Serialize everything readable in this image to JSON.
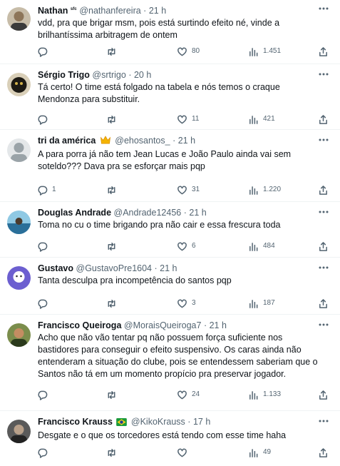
{
  "tweets": [
    {
      "name": "Nathan",
      "name_extra": "ˢᶠᶜ",
      "handle": "@nathanfereira",
      "time": "21 h",
      "text": "vdd, pra que brigar msm, pois está surtindo efeito né, vinde a brilhantíssima arbitragem de ontem",
      "replies": "",
      "retweets": "",
      "likes": "80",
      "views": "1.451",
      "avatar_color": "#b9a98f"
    },
    {
      "name": "Sérgio Trigo",
      "name_extra": "",
      "handle": "@srtrigo",
      "time": "20 h",
      "text": "Tá certo! O time está folgado na tabela e nós temos o craque Mendonza para substituir.",
      "replies": "",
      "retweets": "",
      "likes": "11",
      "views": "421",
      "avatar_color": "#6b5a35"
    },
    {
      "name": "tri da américa",
      "name_extra": "",
      "handle": "@ehosantos_",
      "time": "21 h",
      "text": "A para porra já não tem Jean Lucas e João Paulo ainda vai sem soteldo??? Dava pra se esforçar mais pqp",
      "replies": "1",
      "retweets": "",
      "likes": "31",
      "views": "1.220",
      "avatar_color": "#cfd3d6"
    },
    {
      "name": "Douglas Andrade",
      "name_extra": "",
      "handle": "@Andrade12456",
      "time": "21 h",
      "text": "Toma no cu o time brigando pra não cair e essa frescura toda",
      "replies": "",
      "retweets": "",
      "likes": "6",
      "views": "484",
      "avatar_color": "#2f7fa8"
    },
    {
      "name": "Gustavo",
      "name_extra": "",
      "handle": "@GustavoPre1604",
      "time": "21 h",
      "text": "Tanta desculpa pra incompetência do santos pqp",
      "replies": "",
      "retweets": "",
      "likes": "3",
      "views": "187",
      "avatar_color": "#8a7fd8"
    },
    {
      "name": "Francisco Queiroga",
      "name_extra": "",
      "handle": "@MoraisQueiroga7",
      "time": "21 h",
      "text": "Acho que não vão tentar pq não possuem força suficiente nos bastidores para conseguir o efeito suspensivo. Os caras ainda não entenderam a situação do clube, pois se entendessem saberiam que o Santos não tá em um momento propício pra preservar jogador.",
      "replies": "",
      "retweets": "",
      "likes": "24",
      "views": "1.133",
      "avatar_color": "#5a6b3a"
    },
    {
      "name": "Francisco Krauss",
      "name_extra": "",
      "handle": "@KikoKrauss",
      "time": "17 h",
      "text": "Desgate e o que os torcedores está tendo com esse time haha",
      "replies": "",
      "retweets": "",
      "likes": "",
      "views": "49",
      "avatar_color": "#4d4d4d"
    }
  ],
  "colors": {
    "text": "#0f1419",
    "muted": "#536471",
    "divider": "#eff3f4",
    "crown": "#f4b400",
    "flag_green": "#1a9a3a",
    "flag_yellow": "#f7d117",
    "flag_blue": "#1c3f94"
  },
  "icons": [
    "reply-icon",
    "retweet-icon",
    "like-icon",
    "views-icon",
    "share-icon",
    "more-icon",
    "crown-icon",
    "brazil-flag-icon"
  ]
}
